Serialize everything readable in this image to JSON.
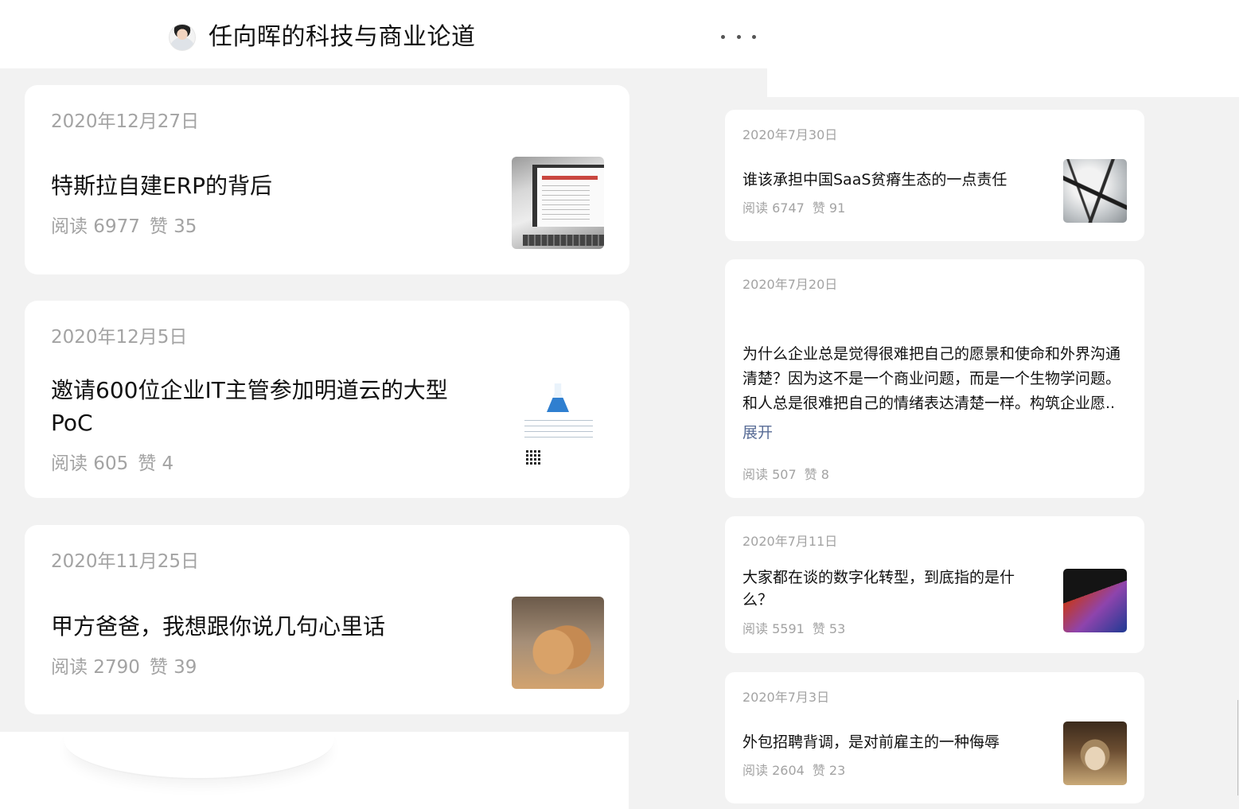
{
  "account": {
    "name": "任向晖的科技与商业论道",
    "more_icon": "more-dots-icon"
  },
  "left_articles": [
    {
      "date": "2020年12月27日",
      "title": "特斯拉自建ERP的背后",
      "reads": "阅读 6977",
      "likes": "赞 35",
      "thumb_icon": "laptop-erp-thumbnail"
    },
    {
      "date": "2020年12月5日",
      "title": "邀请600位企业IT主管参加明道云的大型PoC",
      "reads": "阅读 605",
      "likes": "赞 4",
      "thumb_icon": "flask-poster-thumbnail"
    },
    {
      "date": "2020年11月25日",
      "title": "甲方爸爸，我想跟你说几句心里话",
      "reads": "阅读 2790",
      "likes": "赞 39",
      "thumb_icon": "dog-flower-thumbnail"
    }
  ],
  "right_articles": [
    {
      "date": "2020年7月30日",
      "title": "谁该承担中国SaaS贫瘠生态的一点责任",
      "reads": "阅读 6747",
      "likes": "赞 91",
      "thumb_icon": "cracked-earth-thumbnail"
    },
    {
      "date": "2020年7月20日",
      "body": "为什么企业总是觉得很难把自己的愿景和使命和外界沟通清楚？因为这不是一个商业问题，而是一个生物学问题。和人总是很难把自己的情绪表达清楚一样。构筑企业愿..",
      "expand_label": "展开",
      "reads": "阅读 507",
      "likes": "赞 8"
    },
    {
      "date": "2020年7月11日",
      "title": "大家都在谈的数字化转型，到底指的是什么？",
      "reads": "阅读 5591",
      "likes": "赞 53",
      "thumb_icon": "laptop-keyboard-thumbnail"
    },
    {
      "date": "2020年7月3日",
      "title": "外包招聘背调，是对前雇主的一种侮辱",
      "reads": "阅读 2604",
      "likes": "赞 23",
      "thumb_icon": "cat-thumbnail"
    }
  ],
  "colors": {
    "background": "#f2f2f2",
    "card": "#ffffff",
    "muted_text": "#a3a3a3",
    "link": "#576b95"
  }
}
